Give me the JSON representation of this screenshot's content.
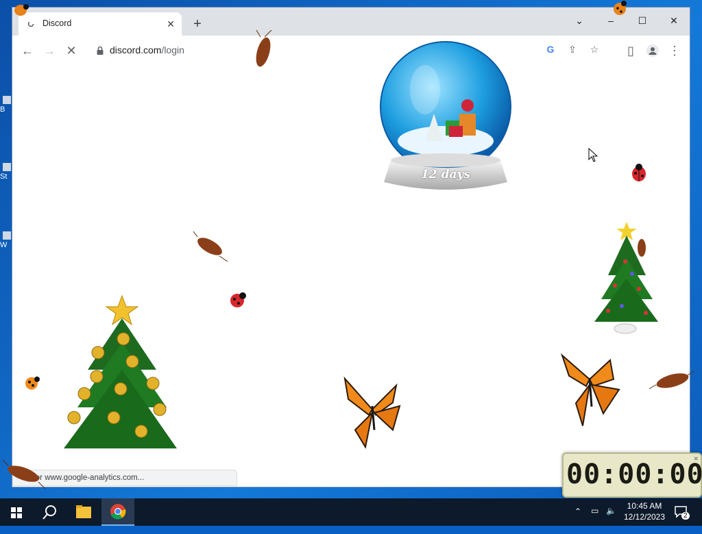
{
  "browser": {
    "tab_title": "Discord",
    "new_tab_label": "+",
    "url_host": "discord.com",
    "url_path": "/login",
    "status_text": "g for www.google-analytics.com..."
  },
  "overlay": {
    "globe_label": "12 days",
    "timer": "00:00:00"
  },
  "taskbar": {
    "time": "10:45 AM",
    "date": "12/12/2023",
    "notification_count": "2"
  },
  "desktop": {
    "icon_fragments": [
      "B",
      "St",
      "W"
    ]
  }
}
